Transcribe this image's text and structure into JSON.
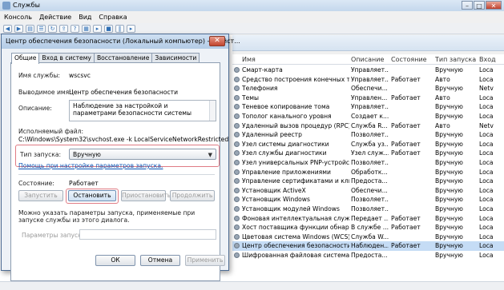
{
  "window": {
    "title": "Службы",
    "controls": [
      "–",
      "□",
      "✕"
    ]
  },
  "menu": [
    "Консоль",
    "Действие",
    "Вид",
    "Справка"
  ],
  "toolbar_icons": [
    "back-icon",
    "forward-icon",
    "console-tree-icon",
    "list-icon",
    "refresh-icon",
    "export-icon",
    "help-icon",
    "properties-icon",
    "play-icon",
    "stop-icon",
    "pause-icon",
    "restart-icon"
  ],
  "grid": {
    "headers": [
      "Имя",
      "Описание",
      "Состояние",
      "Тип запуска",
      "Вход"
    ],
    "rows": [
      {
        "name": "Смарт-карта",
        "desc": "Управляет...",
        "state": "",
        "start": "Вручную",
        "logon": "Loca"
      },
      {
        "name": "Средство построения конечных точ...",
        "desc": "Управляет...",
        "state": "Работает",
        "start": "Авто",
        "logon": "Loca"
      },
      {
        "name": "Телефония",
        "desc": "Обеспечи...",
        "state": "",
        "start": "Вручную",
        "logon": "Netv"
      },
      {
        "name": "Темы",
        "desc": "Управлен...",
        "state": "Работает",
        "start": "Авто",
        "logon": "Loca"
      },
      {
        "name": "Теневое копирование тома",
        "desc": "Управляет...",
        "state": "",
        "start": "Вручную",
        "logon": "Loca"
      },
      {
        "name": "Тополог канального уровня",
        "desc": "Создает к...",
        "state": "",
        "start": "Вручную",
        "logon": "Loca"
      },
      {
        "name": "Удаленный вызов процедур (RPC)",
        "desc": "Служба R...",
        "state": "Работает",
        "start": "Авто",
        "logon": "Netv"
      },
      {
        "name": "Удаленный реестр",
        "desc": "Позволяет...",
        "state": "",
        "start": "Вручную",
        "logon": "Loca"
      },
      {
        "name": "Узел системы диагностики",
        "desc": "Служба уз...",
        "state": "Работает",
        "start": "Вручную",
        "logon": "Loca"
      },
      {
        "name": "Узел службы диагностики",
        "desc": "Узел служ...",
        "state": "Работает",
        "start": "Вручную",
        "logon": "Loca"
      },
      {
        "name": "Узел универсальных PNP-устройств",
        "desc": "Позволяет...",
        "state": "",
        "start": "Вручную",
        "logon": "Loca"
      },
      {
        "name": "Управление приложениями",
        "desc": "Обработк...",
        "state": "",
        "start": "Вручную",
        "logon": "Loca"
      },
      {
        "name": "Управление сертификатами и клю...",
        "desc": "Предоста...",
        "state": "",
        "start": "Вручную",
        "logon": "Loca"
      },
      {
        "name": "Установщик ActiveX",
        "desc": "Обеспечи...",
        "state": "",
        "start": "Вручную",
        "logon": "Loca"
      },
      {
        "name": "Установщик Windows",
        "desc": "Позволяет...",
        "state": "",
        "start": "Вручную",
        "logon": "Loca"
      },
      {
        "name": "Установщик модулей Windows",
        "desc": "Позволяет...",
        "state": "",
        "start": "Вручную",
        "logon": "Loca"
      },
      {
        "name": "Фоновая интеллектуальная служба ...",
        "desc": "Передает ...",
        "state": "Работает",
        "start": "Вручную",
        "logon": "Loca"
      },
      {
        "name": "Хост поставщика функции обнаруж...",
        "desc": "В службе ...",
        "state": "Работает",
        "start": "Вручную",
        "logon": "Loca"
      },
      {
        "name": "Цветовая система Windows (WCS)",
        "desc": "Служба W...",
        "state": "",
        "start": "Вручную",
        "logon": "Loca"
      },
      {
        "name": "Центр обеспечения безопасности",
        "desc": "Наблюден...",
        "state": "Работает",
        "start": "Вручную",
        "logon": "Loca"
      },
      {
        "name": "Шифрованная файловая система (EFS)",
        "desc": "Предоста...",
        "state": "",
        "start": "Вручную",
        "logon": "Loca"
      }
    ]
  },
  "dialog": {
    "title": "Центр обеспечения безопасности (Локальный компьютер) - свойст...",
    "close": "✕",
    "tabs": [
      "Общие",
      "Вход в систему",
      "Восстановление",
      "Зависимости"
    ],
    "service_name_label": "Имя службы:",
    "service_name": "wscsvc",
    "display_name_label": "Выводимое имя:",
    "display_name": "Центр обеспечения безопасности",
    "description_label": "Описание:",
    "description": "Наблюдение за настройкой и параметрами безопасности системы",
    "exe_label": "Исполняемый файл:",
    "exe_path": "C:\\Windows\\System32\\svchost.exe -k LocalServiceNetworkRestricted",
    "startup_label": "Тип запуска:",
    "startup_value": "Вручную",
    "help_link": "Помощь при настройке параметров запуска.",
    "state_label": "Состояние:",
    "state_value": "Работает",
    "btn_start": "Запустить",
    "btn_stop": "Остановить",
    "btn_pause": "Приостановить",
    "btn_resume": "Продолжить",
    "hint": "Можно указать параметры запуска, применяемые при запуске службы из этого диалога.",
    "params_label": "Параметры запуска:",
    "params_value": "",
    "ok": "ОК",
    "cancel": "Отмена",
    "apply": "Применить"
  }
}
